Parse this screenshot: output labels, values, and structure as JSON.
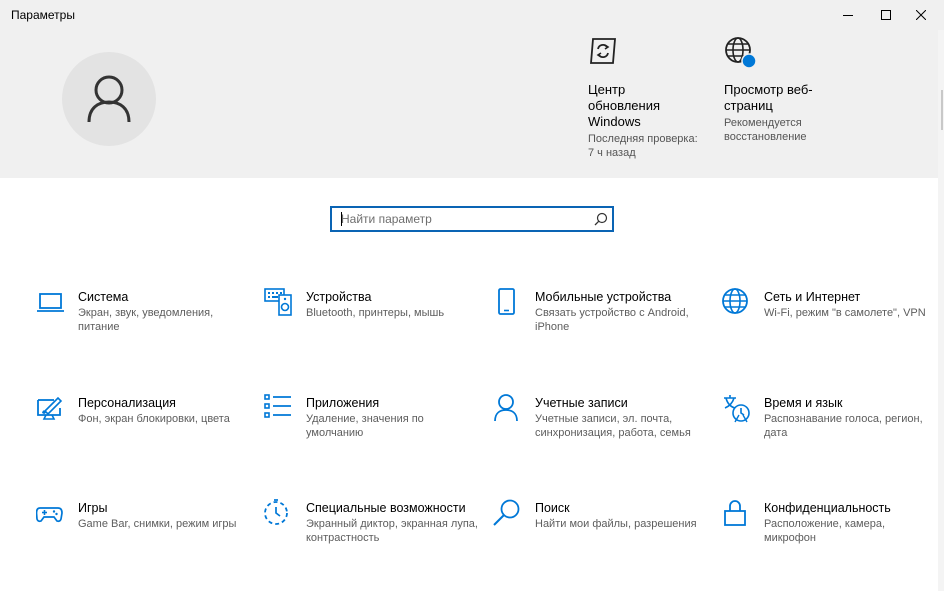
{
  "window": {
    "title": "Параметры",
    "accent": "#0078d7",
    "search_border": "#0a64b4"
  },
  "header": {
    "tiles": [
      {
        "icon": "windows-update-icon",
        "name": "Центр обновления Windows",
        "subtitle": "Последняя проверка: 7 ч назад"
      },
      {
        "icon": "globe-badge-icon",
        "name": "Просмотр веб-страниц",
        "subtitle": "Рекомендуется восстановление"
      }
    ]
  },
  "search": {
    "placeholder": "Найти параметр",
    "value": ""
  },
  "categories": [
    {
      "icon": "laptop-icon",
      "name": "Система",
      "description": "Экран, звук, уведомления, питание"
    },
    {
      "icon": "keyboard-speaker-icon",
      "name": "Устройства",
      "description": "Bluetooth, принтеры, мышь"
    },
    {
      "icon": "phone-icon",
      "name": "Мобильные устройства",
      "description": "Связать устройство с Android, iPhone"
    },
    {
      "icon": "globe-icon",
      "name": "Сеть и Интернет",
      "description": "Wi-Fi, режим \"в самолете\", VPN"
    },
    {
      "icon": "paint-monitor-icon",
      "name": "Персонализация",
      "description": "Фон, экран блокировки, цвета"
    },
    {
      "icon": "apps-list-icon",
      "name": "Приложения",
      "description": "Удаление, значения по умолчанию"
    },
    {
      "icon": "person-icon",
      "name": "Учетные записи",
      "description": "Учетные записи, эл. почта, синхронизация, работа, семья"
    },
    {
      "icon": "time-language-icon",
      "name": "Время и язык",
      "description": "Распознавание голоса, регион, дата"
    },
    {
      "icon": "gamepad-icon",
      "name": "Игры",
      "description": "Game Bar, снимки, режим игры"
    },
    {
      "icon": "accessibility-timer-icon",
      "name": "Специальные возможности",
      "description": "Экранный диктор, экранная лупа, контрастность"
    },
    {
      "icon": "search-icon",
      "name": "Поиск",
      "description": "Найти мои файлы, разрешения"
    },
    {
      "icon": "lock-icon",
      "name": "Конфиденциальность",
      "description": "Расположение, камера, микрофон"
    }
  ]
}
